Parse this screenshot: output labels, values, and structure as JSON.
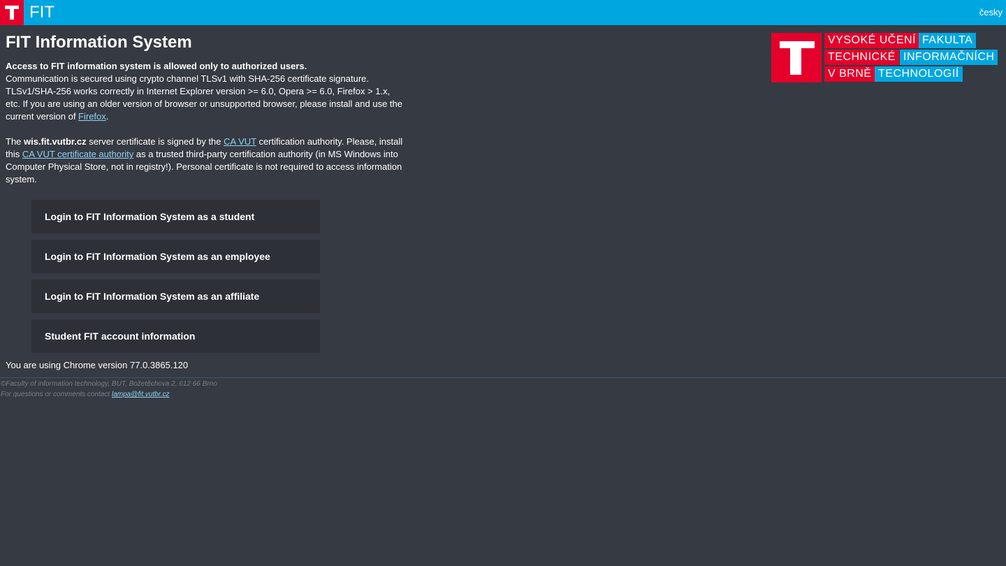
{
  "topbar": {
    "logo_text": "FIT",
    "lang_link": "česky"
  },
  "main": {
    "title": "FIT Information System",
    "access_heading": "Access to FIT information system is allowed only to authorized users.",
    "paragraph1_a": "Communication is secured using crypto channel TLSv1 with SHA-256 certificate signature. TLSv1/SHA-256 works correctly in Internet Explorer version >= 6.0, Opera >= 6.0, Firefox > 1.x, etc. If you are using an older version of browser or unsupported browser, please install and use the current version of ",
    "paragraph1_link": "Firefox",
    "paragraph1_end": ".",
    "paragraph2_a": "The ",
    "paragraph2_bold": "wis.fit.vutbr.cz",
    "paragraph2_b": " server certificate is signed by the ",
    "paragraph2_link1": "CA VUT",
    "paragraph2_c": " certification authority. Please, install this ",
    "paragraph2_link2": "CA VUT certificate authority",
    "paragraph2_d": " as a trusted third-party certification authority (in MS Windows into Computer Physical Store, not in registry!). Personal certificate is not required to access information system.",
    "buttons": [
      {
        "label": "Login to FIT Information System as a student"
      },
      {
        "label": "Login to FIT Information System as an employee"
      },
      {
        "label": "Login to FIT Information System as an affiliate"
      },
      {
        "label": "Student FIT account information"
      }
    ],
    "version_line": "You are using Chrome version 77.0.3865.120"
  },
  "footer": {
    "line1": "©Faculty of information technology, BUT, Božetěchova 2, 612 66 Brno",
    "line2_prefix": "For questions or comments contact ",
    "line2_link": "lampa@fit.vutbr.cz"
  },
  "vut_logo": {
    "words_row1": [
      "VYSOKÉ UČENÍ",
      "FAKULTA"
    ],
    "words_row2": [
      "TECHNICKÉ",
      "INFORMAČNÍCH"
    ],
    "words_row3": [
      "V BRNĚ",
      "TECHNOLOGIÍ"
    ]
  },
  "colors": {
    "brand_red": "#e4002b",
    "brand_blue": "#00a6e0",
    "background": "#363a42",
    "button_bg": "#2d3037",
    "link": "#8fd3f4"
  }
}
